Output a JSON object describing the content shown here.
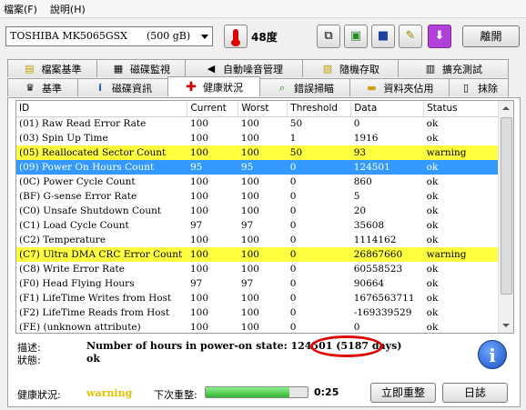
{
  "menu": {
    "file": "檔案(F)",
    "help": "說明(H)"
  },
  "toolbar": {
    "drive": "TOSHIBA MK5065GSX      (500 gB)",
    "temperature": "48度",
    "close_label": "離開",
    "icons": [
      "copy-icon",
      "paste-icon",
      "save-icon",
      "tool-icon",
      "download-icon"
    ],
    "accent_download": "#b040d8"
  },
  "tabs_top": [
    {
      "label": "檔案基準",
      "icon": "file-benchmark-icon"
    },
    {
      "label": "磁碟監視",
      "icon": "disk-monitor-icon"
    },
    {
      "label": "自動噪音管理",
      "icon": "speaker-icon"
    },
    {
      "label": "隨機存取",
      "icon": "random-access-icon"
    },
    {
      "label": "擴充測試",
      "icon": "extra-test-icon"
    }
  ],
  "tabs_bottom": [
    {
      "label": "基準",
      "icon": "benchmark-icon"
    },
    {
      "label": "磁碟資訊",
      "icon": "info-icon"
    },
    {
      "label": "健康狀況",
      "icon": "health-cross-icon"
    },
    {
      "label": "錯誤掃瞄",
      "icon": "magnifier-icon"
    },
    {
      "label": "資料夾佔用",
      "icon": "folder-icon"
    },
    {
      "label": "抹除",
      "icon": "trash-icon"
    }
  ],
  "table": {
    "headers": [
      "ID",
      "Current",
      "Worst",
      "Threshold",
      "Data",
      "Status"
    ],
    "rows": [
      [
        "(01) Raw Read Error Rate",
        "100",
        "100",
        "50",
        "0",
        "ok"
      ],
      [
        "(03) Spin Up Time",
        "100",
        "100",
        "1",
        "1916",
        "ok"
      ],
      [
        "(05) Reallocated Sector Count",
        "100",
        "100",
        "50",
        "93",
        "warning"
      ],
      [
        "(09) Power On Hours Count",
        "95",
        "95",
        "0",
        "124501",
        "ok"
      ],
      [
        "(0C) Power Cycle Count",
        "100",
        "100",
        "0",
        "860",
        "ok"
      ],
      [
        "(BF) G-sense Error Rate",
        "100",
        "100",
        "0",
        "5",
        "ok"
      ],
      [
        "(C0) Unsafe Shutdown Count",
        "100",
        "100",
        "0",
        "20",
        "ok"
      ],
      [
        "(C1) Load Cycle Count",
        "97",
        "97",
        "0",
        "35608",
        "ok"
      ],
      [
        "(C2) Temperature",
        "100",
        "100",
        "0",
        "1114162",
        "ok"
      ],
      [
        "(C7) Ultra DMA CRC Error Count",
        "100",
        "100",
        "0",
        "26867660",
        "warning"
      ],
      [
        "(C8) Write Error Rate",
        "100",
        "100",
        "0",
        "60558523",
        "ok"
      ],
      [
        "(F0) Head Flying Hours",
        "97",
        "97",
        "0",
        "90664",
        "ok"
      ],
      [
        "(F1) LifeTime Writes from Host",
        "100",
        "100",
        "0",
        "1676563711",
        "ok"
      ],
      [
        "(F2) LifeTime Reads from Host",
        "100",
        "100",
        "0",
        "-169339529",
        "ok"
      ],
      [
        "(FE) (unknown attribute)",
        "100",
        "100",
        "0",
        "0",
        "ok"
      ]
    ],
    "warning_rows": [
      2,
      9
    ],
    "selected_row": 3,
    "warning_color": "#ffff40",
    "selected_color": "#3399ff"
  },
  "details": {
    "desc_label": "描述:",
    "desc_value": "Number of hours in power-on state: 124501 (5187 days)",
    "status_label": "狀態:",
    "status_value": "ok"
  },
  "footer": {
    "health_label": "健康狀況:",
    "health_value": "warning",
    "refresh_label": "下次重整:",
    "progress_fraction": 0.82,
    "timer": "0:25",
    "refresh_button": "立即重整",
    "log_button": "日誌"
  }
}
